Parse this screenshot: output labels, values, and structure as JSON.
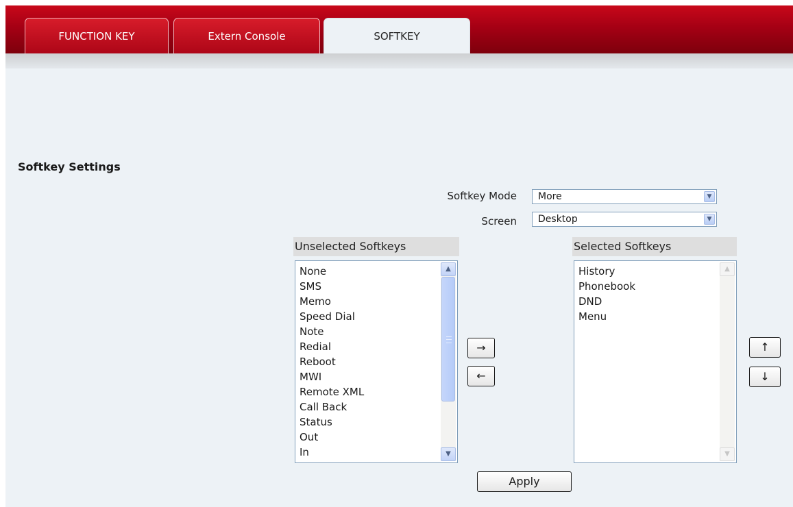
{
  "tabs": [
    {
      "label": "FUNCTION KEY",
      "active": false
    },
    {
      "label": "Extern Console",
      "active": false
    },
    {
      "label": "SOFTKEY",
      "active": true
    }
  ],
  "section_title": "Softkey Settings",
  "softkey_mode": {
    "label": "Softkey Mode",
    "value": "More"
  },
  "screen": {
    "label": "Screen",
    "value": "Desktop"
  },
  "unselected": {
    "header": "Unselected Softkeys",
    "items": [
      "None",
      "SMS",
      "Memo",
      "Speed Dial",
      "Note",
      "Redial",
      "Reboot",
      "MWI",
      "Remote XML",
      "Call Back",
      "Status",
      "Out",
      "In"
    ]
  },
  "selected": {
    "header": "Selected Softkeys",
    "items": [
      "History",
      "Phonebook",
      "DND",
      "Menu"
    ]
  },
  "buttons": {
    "move_right": "→",
    "move_left": "←",
    "move_up": "↑",
    "move_down": "↓",
    "apply": "Apply"
  },
  "icons": {
    "dropdown": "chevron-down-icon",
    "scroll_up": "scroll-up-icon",
    "scroll_down": "scroll-down-icon"
  }
}
